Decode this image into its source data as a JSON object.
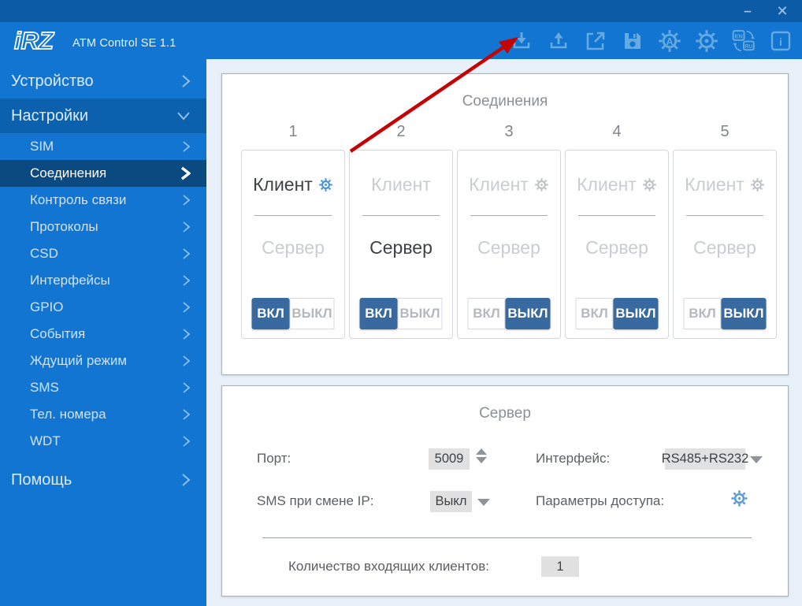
{
  "window": {
    "brand": "iRZ",
    "title": "ATM Control SE 1.1",
    "minimize": "–",
    "close": "✕"
  },
  "toolbar": {
    "lang_top": "EN",
    "lang_bottom": "RU",
    "auto_letter": "A",
    "info_letter": "i",
    "icons": [
      "download",
      "upload",
      "open",
      "save",
      "auto-settings",
      "settings",
      "language",
      "info"
    ]
  },
  "sidebar": {
    "device": "Устройство",
    "settings": "Настройки",
    "items": [
      "SIM",
      "Соединения",
      "Контроль связи",
      "Протоколы",
      "CSD",
      "Интерфейсы",
      "GPIO",
      "События",
      "Ждущий режим",
      "SMS",
      "Тел. номера",
      "WDT"
    ],
    "help": "Помощь",
    "selected": "Соединения"
  },
  "connections": {
    "title": "Соединения",
    "labels": {
      "client": "Клиент",
      "server": "Сервер",
      "on": "ВКЛ",
      "off": "ВЫКЛ"
    },
    "cards": [
      {
        "number": "1",
        "active_mode": "Клиент",
        "toggle": "ВКЛ",
        "client_gear": true
      },
      {
        "number": "2",
        "active_mode": "Сервер",
        "toggle": "ВКЛ",
        "client_gear": false
      },
      {
        "number": "3",
        "active_mode": "",
        "toggle": "ВЫКЛ",
        "client_gear": true
      },
      {
        "number": "4",
        "active_mode": "",
        "toggle": "ВЫКЛ",
        "client_gear": true
      },
      {
        "number": "5",
        "active_mode": "",
        "toggle": "ВЫКЛ",
        "client_gear": true
      }
    ]
  },
  "server": {
    "title": "Сервер",
    "port_label": "Порт:",
    "port_value": "5009",
    "interface_label": "Интерфейс:",
    "interface_value": "RS485+RS232",
    "sms_label": "SMS при смене IP:",
    "sms_value": "Выкл",
    "access_label": "Параметры доступа:",
    "clients_label": "Количество входящих клиентов:",
    "clients_value": "1"
  },
  "annotation": {
    "type": "arrow",
    "points_to": "download-icon",
    "color": "#c40404"
  },
  "colors": {
    "titlebar": "#0c5ba6",
    "header": "#1175d1",
    "sidebar_selected": "#0a4a80",
    "section_expanded": "#0b61ae",
    "toggle_active": "#38699f",
    "gear_active": "#4591da",
    "content_bg": "#e8f1f9",
    "field_bg": "#e1e1e1",
    "arrow_red": "#c40404"
  }
}
